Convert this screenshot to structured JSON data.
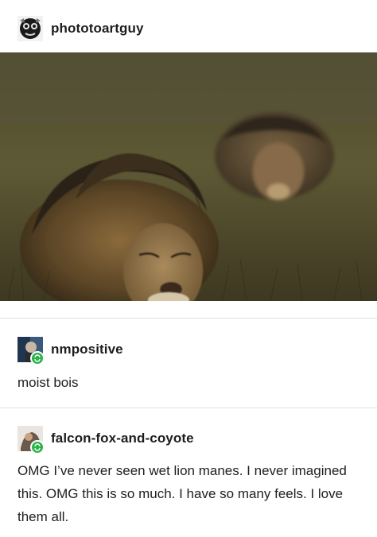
{
  "post": {
    "author": "phototoartguy",
    "image_description_icon": "photo-lions-in-rain"
  },
  "reblogs": [
    {
      "username": "nmpositive",
      "text": "moist bois"
    },
    {
      "username": "falcon-fox-and-coyote",
      "text": "OMG I’ve never seen wet lion manes. I never imagined this. OMG this is so much. I have so many feels. I love them all."
    }
  ],
  "colors": {
    "reblog_badge": "#2bb34a",
    "divider": "#e3e3e3"
  }
}
